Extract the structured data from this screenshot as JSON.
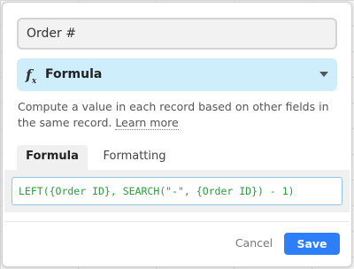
{
  "field": {
    "name_value": "Order #"
  },
  "field_type": {
    "icon": "formula-fx-icon",
    "label": "Formula"
  },
  "description": {
    "text": "Compute a value in each record based on other fields in the same record.",
    "learn_more": "Learn more"
  },
  "tabs": [
    {
      "label": "Formula",
      "active": true
    },
    {
      "label": "Formatting",
      "active": false
    }
  ],
  "formula": {
    "value": "LEFT({Order ID}, SEARCH(\"-\", {Order ID}) - 1)"
  },
  "footer": {
    "cancel_label": "Cancel",
    "save_label": "Save"
  },
  "colors": {
    "accent": "#2d7ff9",
    "type_select_bg": "#cfeefc",
    "formula_text": "#2f9a3b"
  }
}
